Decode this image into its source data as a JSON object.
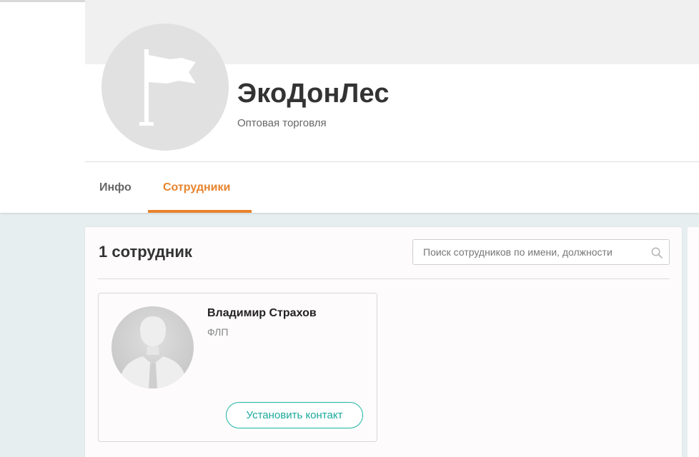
{
  "company": {
    "name": "ЭкоДонЛес",
    "type": "Оптовая торговля"
  },
  "tabs": [
    {
      "label": "Инфо",
      "active": false
    },
    {
      "label": "Сотрудники",
      "active": true
    }
  ],
  "staff": {
    "count_label": "1 сотрудник",
    "search_placeholder": "Поиск сотрудников по имени, должности",
    "employees": [
      {
        "name": "Владимир Страхов",
        "role": "ФЛП",
        "action_label": "Установить контакт"
      }
    ]
  },
  "colors": {
    "accent": "#e8832d",
    "contact": "#1fb5a8",
    "background": "#e6eef0"
  },
  "icons": {
    "company_avatar": "flag-icon",
    "search": "search-icon",
    "employee_avatar": "person-silhouette-icon"
  }
}
